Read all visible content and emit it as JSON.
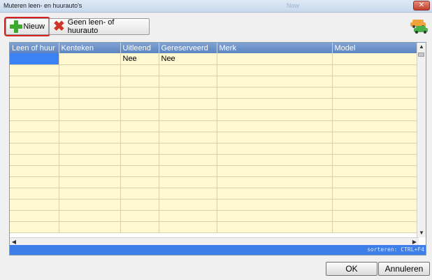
{
  "window": {
    "title": "Muteren leen- en huurauto's",
    "ghost_tab": "Now"
  },
  "toolbar": {
    "new_label": "Nieuw",
    "none_label": "Geen leen- of huurauto",
    "new_icon": "plus-icon",
    "none_icon": "x-icon",
    "car_icon": "cars-icon"
  },
  "grid": {
    "columns": [
      "Leen of huur",
      "Kenteken",
      "Uitleend",
      "Gereserveerd",
      "Merk",
      "Model"
    ],
    "rows": [
      [
        "",
        "",
        "Nee",
        "Nee",
        "",
        ""
      ]
    ],
    "sort_hint": "sorteren: CTRL+F4"
  },
  "dialog": {
    "ok_label": "OK",
    "cancel_label": "Annuleren"
  },
  "colors": {
    "header": "#6b90c9",
    "row": "#fff8d0",
    "selection": "#3b82f5",
    "highlight": "#d61f1f"
  }
}
